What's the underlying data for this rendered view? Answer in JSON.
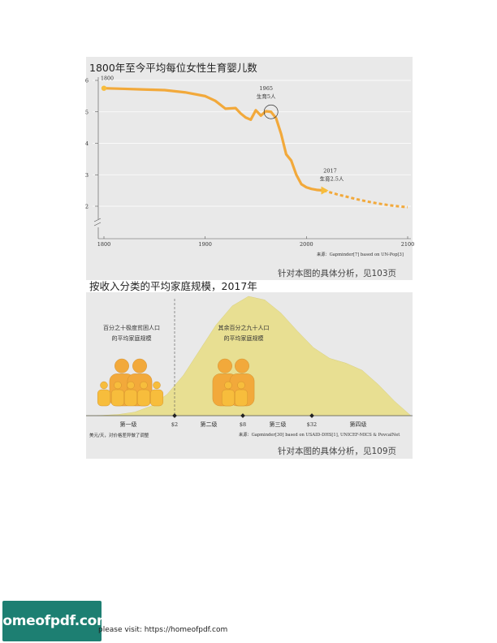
{
  "chart_data": [
    {
      "type": "line",
      "title": "1800年至今平均每位女性生育婴儿数",
      "x": [
        1800,
        1820,
        1840,
        1860,
        1880,
        1900,
        1910,
        1920,
        1930,
        1935,
        1940,
        1945,
        1950,
        1955,
        1960,
        1965,
        1970,
        1975,
        1980,
        1985,
        1990,
        1995,
        2000,
        2005,
        2010,
        2017
      ],
      "series": [
        {
          "values": [
            5.75,
            5.73,
            5.71,
            5.69,
            5.62,
            5.5,
            5.35,
            5.1,
            5.12,
            4.95,
            4.82,
            4.75,
            5.05,
            4.88,
            5.02,
            5.0,
            4.8,
            4.3,
            3.65,
            3.45,
            3.0,
            2.7,
            2.6,
            2.55,
            2.52,
            2.5
          ]
        },
        {
          "style": "dashed",
          "x": [
            2017,
            2030,
            2040,
            2050,
            2060,
            2070,
            2080,
            2090,
            2100
          ],
          "values": [
            2.5,
            2.38,
            2.3,
            2.22,
            2.15,
            2.09,
            2.04,
            2.0,
            1.97
          ]
        }
      ],
      "xticks": [
        "1800",
        "1900",
        "2000",
        "2100"
      ],
      "yticks": [
        "2",
        "3",
        "4",
        "5",
        "6"
      ],
      "xlim": [
        1800,
        2100
      ],
      "ylim": [
        1.2,
        6.2
      ],
      "annotations": [
        {
          "year": "1800",
          "x": 1800,
          "y": 5.75
        },
        {
          "year": "1965",
          "text": "生育5人",
          "x": 1965,
          "y": 5.0
        },
        {
          "year": "2017",
          "text": "生育2.5人",
          "x": 2017,
          "y": 2.5
        }
      ],
      "source": "来源：Gapminder[7] based on UN-Pop[3]",
      "reference": "针对本图的具体分析，见103页",
      "colors": {
        "line": "#f2a93b",
        "marker": "#f7bd3c",
        "circle": "#333333"
      }
    },
    {
      "type": "area",
      "title": "按收入分类的平均家庭规模，2017年",
      "x": [
        0,
        1,
        2,
        3,
        4,
        5,
        6,
        7,
        8,
        9,
        10,
        11,
        12,
        13,
        14,
        15,
        16,
        17,
        18,
        19,
        20
      ],
      "series": [
        {
          "values": [
            0,
            0.3,
            1.0,
            3.0,
            8.0,
            18.0,
            34.0,
            55.0,
            76.0,
            92.0,
            100.0,
            97.0,
            86.0,
            71.0,
            57.0,
            48.0,
            44.0,
            38.0,
            26.0,
            12.0,
            0
          ]
        }
      ],
      "income_markers": [
        "$2",
        "$8",
        "$32"
      ],
      "levels": [
        "第一级",
        "第二级",
        "第三级",
        "第四级"
      ],
      "groups": [
        {
          "label_line1": "百分之十极度贫困人口",
          "label_line2": "的平均家庭规模"
        },
        {
          "label_line1": "其余百分之九十人口",
          "label_line2": "的平均家庭规模"
        }
      ],
      "note": "美元/天，对价格差异做了调整",
      "source": "来源：Gapminder[30] based on USAID-DHS[1], UNICEF-MICS & PovcalNet",
      "reference": "针对本图的具体分析，见109页",
      "colors": {
        "area": "#e8df92",
        "figure": "#f2a93b",
        "figure_light": "#f7bd3c"
      }
    }
  ],
  "footer": {
    "logo": "homeofpdf.com",
    "text": "please visit: https://homeofpdf.com"
  }
}
